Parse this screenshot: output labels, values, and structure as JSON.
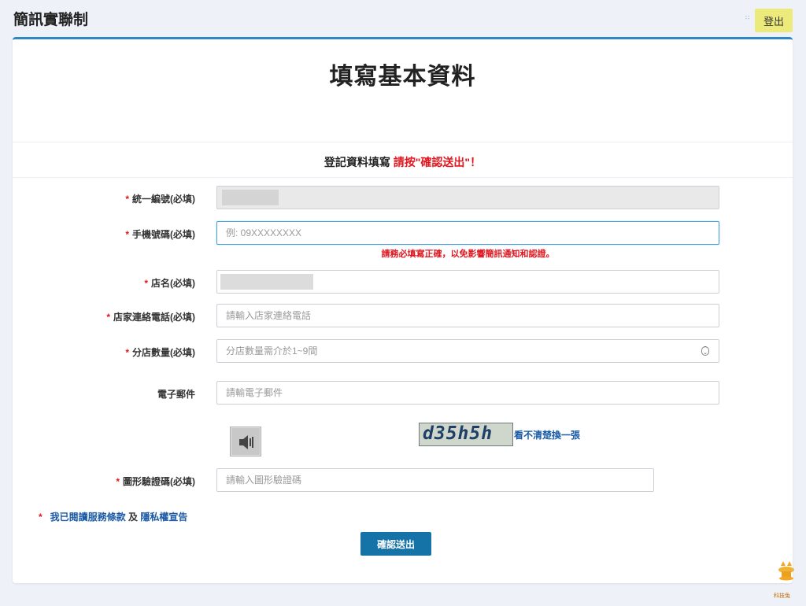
{
  "app": {
    "title": "簡訊實聯制",
    "logout_label": "登出"
  },
  "page": {
    "title": "填寫基本資料"
  },
  "notice": {
    "prefix": "登記資料填寫 ",
    "highlight": "請按\"確認送出\"！"
  },
  "required_mark": "*",
  "form": {
    "tax_id": {
      "label": "統一編號(必填)"
    },
    "mobile": {
      "label": "手機號碼(必填)",
      "placeholder": "例: 09XXXXXXXX",
      "hint": "請務必填寫正確，以免影響簡訊通知和認證。"
    },
    "store_name": {
      "label": "店名(必填)"
    },
    "store_phone": {
      "label": "店家連絡電話(必填)",
      "placeholder": "請輸入店家連絡電話"
    },
    "branch_count": {
      "label": "分店數量(必填)",
      "placeholder": "分店數量需介於1~9間"
    },
    "email": {
      "label": "電子郵件",
      "placeholder": "請輸電子郵件"
    },
    "captcha": {
      "image_text": "d35h5h",
      "refresh_label": "看不清楚換一張"
    },
    "captcha_input": {
      "label": "圖形驗證碼(必填)",
      "placeholder": "請輸入圖形驗證碼"
    }
  },
  "terms": {
    "prefix": "我已閱讀",
    "terms_link": "服務條款",
    "and": " 及 ",
    "privacy_link": "隱私權宣告"
  },
  "submit_label": "確認送出",
  "mascot_label": "科技兔",
  "icons": {
    "menu": "dots-icon",
    "audio": "speaker-icon",
    "spinner": "spinner-icon",
    "mascot": "mascot-icon"
  },
  "colors": {
    "accent": "#1573a8",
    "required": "#e0161e",
    "logout_bg": "#ecea7a",
    "link": "#1a5aa5"
  }
}
